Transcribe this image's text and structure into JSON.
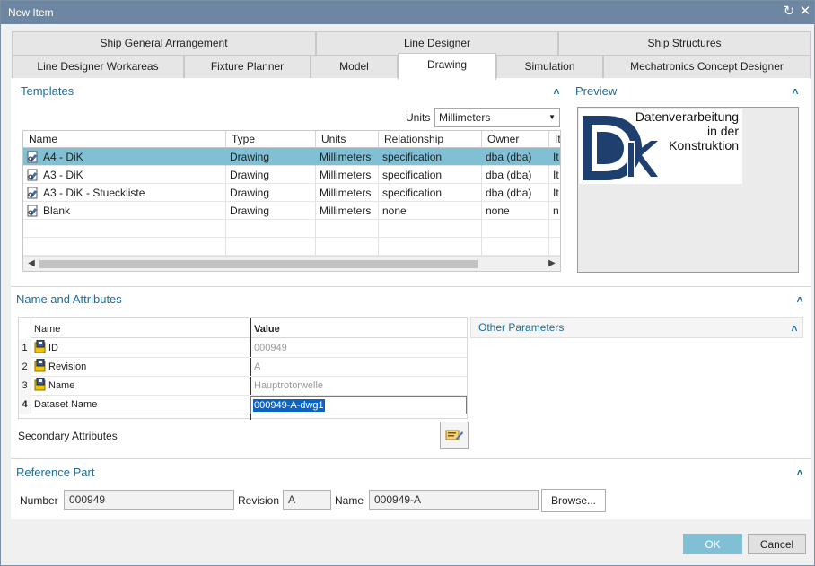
{
  "window": {
    "title": "New Item",
    "refresh_icon": "refresh-icon",
    "close_icon": "close-icon"
  },
  "tabs_row1": [
    {
      "label": "Ship General Arrangement"
    },
    {
      "label": "Line Designer"
    },
    {
      "label": "Ship Structures"
    }
  ],
  "tabs_row2": [
    {
      "label": "Line Designer Workareas"
    },
    {
      "label": "Fixture Planner"
    },
    {
      "label": "Model"
    },
    {
      "label": "Drawing"
    },
    {
      "label": "Simulation"
    },
    {
      "label": "Mechatronics Concept Designer"
    }
  ],
  "templates": {
    "title": "Templates",
    "units_label": "Units",
    "units_value": "Millimeters",
    "columns": [
      "Name",
      "Type",
      "Units",
      "Relationship",
      "Owner",
      "It"
    ],
    "rows": [
      {
        "name": "A4 - DiK",
        "type": "Drawing",
        "units": "Millimeters",
        "relationship": "specification",
        "owner": "dba (dba)",
        "it": "It"
      },
      {
        "name": "A3 - DiK",
        "type": "Drawing",
        "units": "Millimeters",
        "relationship": "specification",
        "owner": "dba (dba)",
        "it": "It"
      },
      {
        "name": "A3 - DiK - Stueckliste",
        "type": "Drawing",
        "units": "Millimeters",
        "relationship": "specification",
        "owner": "dba (dba)",
        "it": "It"
      },
      {
        "name": "Blank",
        "type": "Drawing",
        "units": "Millimeters",
        "relationship": "none",
        "owner": "none",
        "it": "n"
      }
    ]
  },
  "preview": {
    "title": "Preview",
    "logo_lines": [
      "Datenverarbeitung",
      "in der",
      "Konstruktion"
    ],
    "logo_mark": "DiK"
  },
  "name_attributes": {
    "title": "Name and Attributes",
    "col_name": "Name",
    "col_value": "Value",
    "rows": [
      {
        "num": "1",
        "name": "ID",
        "value": "000949",
        "icon": true
      },
      {
        "num": "2",
        "name": "Revision",
        "value": "A",
        "icon": true
      },
      {
        "num": "3",
        "name": "Name",
        "value": "Hauptrotorwelle",
        "icon": true
      },
      {
        "num": "4",
        "name": "Dataset Name",
        "value": "000949-A-dwg1",
        "icon": false
      }
    ],
    "secondary_label": "Secondary Attributes",
    "other_params_title": "Other Parameters"
  },
  "reference_part": {
    "title": "Reference Part",
    "number_label": "Number",
    "number_value": "000949",
    "revision_label": "Revision",
    "revision_value": "A",
    "name_label": "Name",
    "name_value": "000949-A",
    "browse_label": "Browse..."
  },
  "footer": {
    "ok_label": "OK",
    "cancel_label": "Cancel"
  },
  "colors": {
    "titlebar": "#6d86a2",
    "accent": "#1b6e9a",
    "selection": "#80bfd4"
  }
}
